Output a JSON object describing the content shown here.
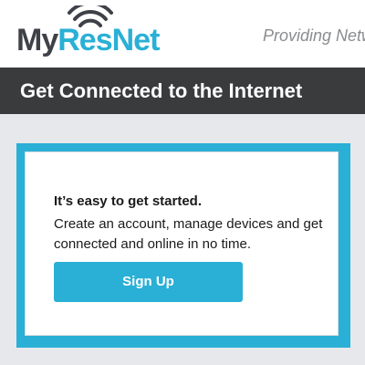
{
  "header": {
    "logo": {
      "part1": "My",
      "part2": "ResNet",
      "colors": {
        "my": "#3f4148",
        "resnet": "#2ab0d6"
      }
    },
    "logo_icon": "wifi-signal-icon",
    "tagline": "Providing Netw"
  },
  "banner": {
    "title": "Get Connected to the Internet",
    "background": "#3a3b3d"
  },
  "card": {
    "heading": "It’s easy to get started.",
    "body": "Create an account, manage devices and get connected and online in no time.",
    "signup_label": "Sign Up",
    "accent": "#2ab0d6"
  }
}
